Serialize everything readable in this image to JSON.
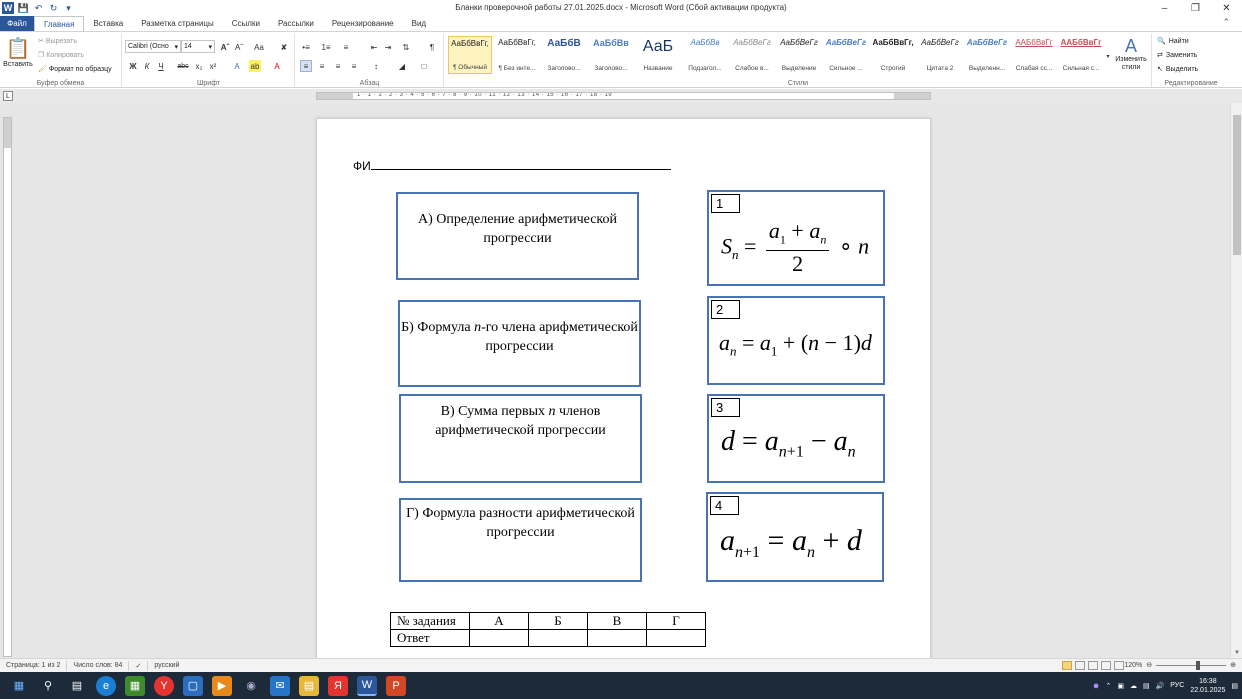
{
  "window": {
    "title": "Бланки проверочной работы 27.01.2025.docx  -  Microsoft Word (Сбой активации продукта)"
  },
  "tabs": [
    {
      "label": "Файл"
    },
    {
      "label": "Главная"
    },
    {
      "label": "Вставка"
    },
    {
      "label": "Разметка страницы"
    },
    {
      "label": "Ссылки"
    },
    {
      "label": "Рассылки"
    },
    {
      "label": "Рецензирование"
    },
    {
      "label": "Вид"
    }
  ],
  "ribbon": {
    "clipboard": {
      "paste": "Вставить",
      "cut": "Вырезать",
      "copy": "Копировать",
      "format_painter": "Формат по образцу",
      "label": "Буфер обмена"
    },
    "font": {
      "name": "Calibri (Осно",
      "size": "14",
      "label": "Шрифт"
    },
    "paragraph": {
      "label": "Абзац"
    },
    "styles": {
      "label": "Стили",
      "change": "Изменить стили",
      "items": [
        {
          "sample": "АаБбВвГг,",
          "name": "¶ Обычный"
        },
        {
          "sample": "АаБбВвГг,",
          "name": "¶ Без инте..."
        },
        {
          "sample": "АаБбВ",
          "name": "Заголово..."
        },
        {
          "sample": "АаБбВв",
          "name": "Заголово..."
        },
        {
          "sample": "АаБ",
          "name": "Название"
        },
        {
          "sample": "АаБбВв",
          "name": "Подзагол..."
        },
        {
          "sample": "АаБбВеГг",
          "name": "Слабое в..."
        },
        {
          "sample": "АаБбВеГг",
          "name": "Выделение"
        },
        {
          "sample": "АаБбВеГг",
          "name": "Сильное ..."
        },
        {
          "sample": "АаБбВвГг,",
          "name": "Строгий"
        },
        {
          "sample": "АаБбВеГг",
          "name": "Цитата 2"
        },
        {
          "sample": "АаБбВеГг",
          "name": "Выделенн..."
        },
        {
          "sample": "ААБбВвГг",
          "name": "Слабая сс..."
        },
        {
          "sample": "ААБбВвГг",
          "name": "Сильная с..."
        }
      ]
    },
    "editing": {
      "label": "Редактирование",
      "find": "Найти",
      "replace": "Заменить",
      "select": "Выделить"
    }
  },
  "ruler": {
    "numbers": "1 · 1 · 1 · 2 · 3 · 4 · 5 · 6 · 7 · 8 · 9 · 10 · 11 · 12 · 13 · 14 · 15 · 16 · 17 · 18 · 19"
  },
  "document": {
    "fio": "ФИ",
    "left_boxes": [
      {
        "text": "А) Определение арифметической прогрессии"
      },
      {
        "text_pre": "Б) Формула ",
        "text_var": "n",
        "text_post": "-го члена арифметической прогрессии"
      },
      {
        "text_pre": "В) Сумма первых ",
        "text_var": "n",
        "text_post": " членов арифметической прогрессии"
      },
      {
        "text": "Г) Формула разности арифметической прогрессии"
      }
    ],
    "right_boxes": [
      {
        "num": "1"
      },
      {
        "num": "2"
      },
      {
        "num": "3"
      },
      {
        "num": "4"
      }
    ],
    "answer_table": {
      "header": [
        "№ задания",
        "А",
        "Б",
        "В",
        "Г"
      ],
      "row": [
        "Ответ",
        "",
        "",
        "",
        ""
      ]
    }
  },
  "statusbar": {
    "page": "Страница: 1 из 2",
    "words": "Число слов: 84",
    "lang": "русский",
    "zoom": "120%"
  },
  "taskbar": {
    "lang": "РУС",
    "time": "16:38",
    "date": "22.01.2025"
  },
  "colors": {
    "accent": "#2b579a",
    "box_border": "#4a73b5"
  }
}
